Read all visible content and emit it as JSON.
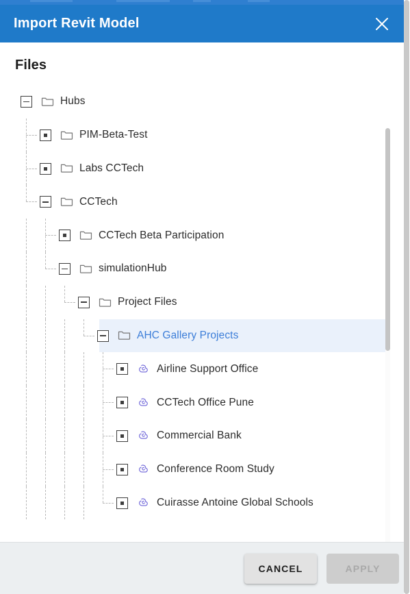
{
  "dialog": {
    "title": "Import Revit Model",
    "close_icon": "close-icon",
    "section_title": "Files",
    "header_color": "#1f7ac9",
    "selected_row_bg": "#eaf1fb",
    "selected_text_color": "#3b7dd8",
    "revit_icon_color": "#6c63d8"
  },
  "tree": {
    "nodes": [
      {
        "label": "Hubs",
        "depth": 0,
        "state": "expanded",
        "icon": "folder-icon"
      },
      {
        "label": "PIM-Beta-Test",
        "depth": 1,
        "state": "collapsed",
        "icon": "folder-icon"
      },
      {
        "label": "Labs CCTech",
        "depth": 1,
        "state": "collapsed",
        "icon": "folder-icon"
      },
      {
        "label": "CCTech",
        "depth": 1,
        "state": "expanded",
        "icon": "folder-icon"
      },
      {
        "label": "CCTech Beta Participation",
        "depth": 2,
        "state": "collapsed",
        "icon": "folder-icon"
      },
      {
        "label": "simulationHub",
        "depth": 2,
        "state": "expanded",
        "icon": "folder-icon"
      },
      {
        "label": "Project Files",
        "depth": 3,
        "state": "expanded",
        "icon": "folder-icon"
      },
      {
        "label": "AHC Gallery Projects",
        "depth": 4,
        "state": "expanded",
        "icon": "folder-icon",
        "selected": true
      },
      {
        "label": "Airline Support Office",
        "depth": 5,
        "state": "collapsed",
        "icon": "revit-icon"
      },
      {
        "label": "CCTech Office Pune",
        "depth": 5,
        "state": "collapsed",
        "icon": "revit-icon"
      },
      {
        "label": "Commercial Bank",
        "depth": 5,
        "state": "collapsed",
        "icon": "revit-icon"
      },
      {
        "label": "Conference Room Study",
        "depth": 5,
        "state": "collapsed",
        "icon": "revit-icon"
      },
      {
        "label": "Cuirasse Antoine Global Schools",
        "depth": 5,
        "state": "collapsed",
        "icon": "revit-icon"
      }
    ]
  },
  "footer": {
    "cancel_label": "CANCEL",
    "apply_label": "APPLY",
    "apply_disabled": true
  },
  "scrollbars": {
    "tree_scrollbar": "tree-vertical-scrollbar",
    "page_scrollbar": "page-vertical-scrollbar"
  }
}
